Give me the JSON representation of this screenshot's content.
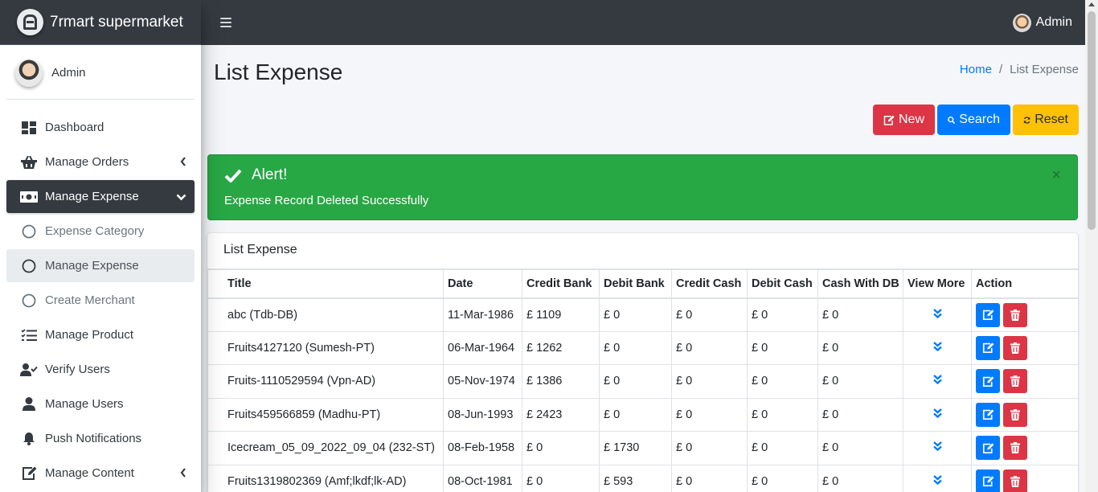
{
  "brand": {
    "name": "7rmart supermarket",
    "logo_icon": "brand-logo-icon"
  },
  "sidebar": {
    "user_name": "Admin",
    "items": [
      {
        "label": "Dashboard",
        "icon": "dashboard-icon"
      },
      {
        "label": "Manage Orders",
        "icon": "basket-icon"
      },
      {
        "label": "Manage Expense",
        "icon": "money-icon"
      },
      {
        "label": "Expense Category",
        "icon": "circle-icon"
      },
      {
        "label": "Manage Expense",
        "icon": "circle-icon"
      },
      {
        "label": "Create Merchant",
        "icon": "circle-icon"
      },
      {
        "label": "Manage Product",
        "icon": "tasks-icon"
      },
      {
        "label": "Verify Users",
        "icon": "user-check-icon"
      },
      {
        "label": "Manage Users",
        "icon": "user-icon"
      },
      {
        "label": "Push Notifications",
        "icon": "bell-icon"
      },
      {
        "label": "Manage Content",
        "icon": "edit-icon"
      }
    ]
  },
  "topbar": {
    "user_name": "Admin"
  },
  "page": {
    "title": "List Expense",
    "breadcrumb": {
      "home": "Home",
      "separator": "/",
      "current": "List Expense"
    }
  },
  "actions": {
    "new": "New",
    "search": "Search",
    "reset": "Reset"
  },
  "alert": {
    "title": "Alert!",
    "message": "Expense Record Deleted Successfully",
    "close": "×"
  },
  "table": {
    "card_title": "List Expense",
    "columns": [
      "Title",
      "Date",
      "Credit Bank",
      "Debit Bank",
      "Credit Cash",
      "Debit Cash",
      "Cash With DB",
      "View More",
      "Action"
    ],
    "rows": [
      [
        "abc (Tdb-DB)",
        "11-Mar-1986",
        "£ 1109",
        "£ 0",
        "£ 0",
        "£ 0",
        "£ 0"
      ],
      [
        "Fruits4127120 (Sumesh-PT)",
        "06-Mar-1964",
        "£ 1262",
        "£ 0",
        "£ 0",
        "£ 0",
        "£ 0"
      ],
      [
        "Fruits-1110529594 (Vpn-AD)",
        "05-Nov-1974",
        "£ 1386",
        "£ 0",
        "£ 0",
        "£ 0",
        "£ 0"
      ],
      [
        "Fruits459566859 (Madhu-PT)",
        "08-Jun-1993",
        "£ 2423",
        "£ 0",
        "£ 0",
        "£ 0",
        "£ 0"
      ],
      [
        "Icecream_05_09_2022_09_04 (232-ST)",
        "08-Feb-1958",
        "£ 0",
        "£ 1730",
        "£ 0",
        "£ 0",
        "£ 0"
      ],
      [
        "Fruits1319802369 (Amf;lkdf;lk-AD)",
        "08-Oct-1981",
        "£ 0",
        "£ 593",
        "£ 0",
        "£ 0",
        "£ 0"
      ]
    ]
  },
  "colors": {
    "sidebar_active": "#343a40",
    "primary": "#007bff",
    "danger": "#dc3545",
    "warning": "#ffc107",
    "success": "#28a745"
  }
}
